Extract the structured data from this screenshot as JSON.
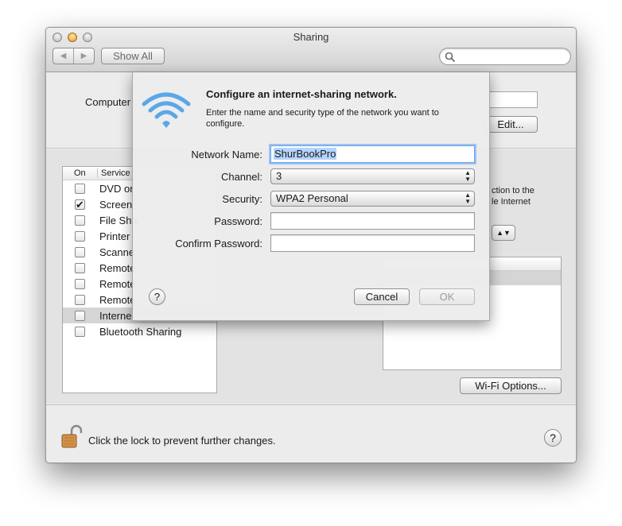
{
  "window": {
    "title": "Sharing",
    "show_all_label": "Show All",
    "search_placeholder": ""
  },
  "upper": {
    "computer_label": "Computer",
    "edit_label": "Edit..."
  },
  "services": {
    "header_on": "On",
    "header_service": "Service",
    "items": [
      {
        "label": "DVD or",
        "checked": false,
        "selected": false
      },
      {
        "label": "Screen",
        "checked": true,
        "selected": false
      },
      {
        "label": "File Sha",
        "checked": false,
        "selected": false
      },
      {
        "label": "Printer",
        "checked": false,
        "selected": false
      },
      {
        "label": "Scanne",
        "checked": false,
        "selected": false
      },
      {
        "label": "Remote",
        "checked": false,
        "selected": false
      },
      {
        "label": "Remote",
        "checked": false,
        "selected": false
      },
      {
        "label": "Remote",
        "checked": false,
        "selected": false
      },
      {
        "label": "Interne",
        "checked": false,
        "selected": true
      },
      {
        "label": "Bluetooth Sharing",
        "checked": false,
        "selected": false
      }
    ]
  },
  "right_pane": {
    "text_line1": "ction to the",
    "text_line2": "le Internet",
    "wifi_options_label": "Wi-Fi Options..."
  },
  "bottom": {
    "lock_text": "Click the lock to prevent further changes.",
    "help_label": "?"
  },
  "sheet": {
    "title": "Configure an internet-sharing network.",
    "description": "Enter the name and security type of the network you want to configure.",
    "network_name_label": "Network Name:",
    "network_name_value": "ShurBookPro",
    "channel_label": "Channel:",
    "channel_value": "3",
    "security_label": "Security:",
    "security_value": "WPA2 Personal",
    "password_label": "Password:",
    "password_value": "",
    "confirm_password_label": "Confirm Password:",
    "confirm_password_value": "",
    "help_label": "?",
    "cancel_label": "Cancel",
    "ok_label": "OK"
  },
  "colors": {
    "focus_ring": "#9cc4f3",
    "selection": "#b5d5ff",
    "wifi_icon": "#5aa7e8",
    "lock_icon": "#d2914a"
  },
  "icons": {
    "search": "magnifier-icon",
    "wifi": "wifi-icon",
    "lock": "open-lock-icon",
    "help": "question-icon"
  }
}
